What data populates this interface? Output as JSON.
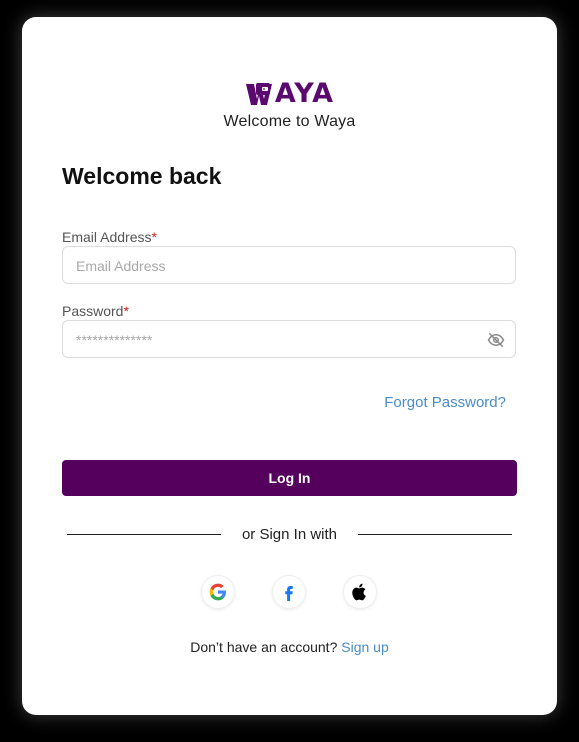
{
  "brand": {
    "logo_text": "AYA",
    "subtitle": "Welcome to Waya",
    "color": "#5a0a6e"
  },
  "form": {
    "title": "Welcome back",
    "email": {
      "label": "Email Address",
      "required_mark": "*",
      "placeholder": "Email Address",
      "value": ""
    },
    "password": {
      "label": "Password",
      "required_mark": "*",
      "placeholder": "**************",
      "value": ""
    },
    "forgot_label": "Forgot Password?",
    "login_label": "Log In",
    "login_color": "#56005e"
  },
  "social": {
    "divider_text": "or Sign In with",
    "providers": [
      "google-icon",
      "facebook-icon",
      "apple-icon"
    ]
  },
  "signup": {
    "prompt": "Don’t have an account?",
    "link": "Sign up",
    "link_color": "#4a8cc7"
  }
}
